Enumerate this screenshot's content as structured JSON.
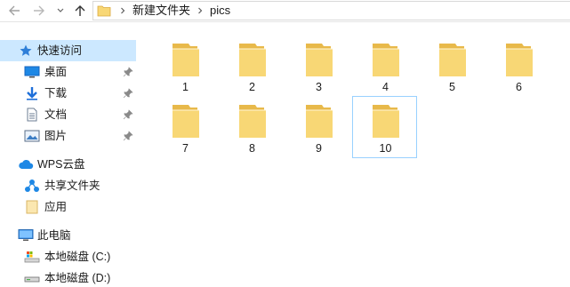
{
  "toolbar": {
    "back_icon": "arrow-left-icon",
    "forward_icon": "arrow-right-icon",
    "recent_icon": "chevron-down-icon",
    "up_icon": "arrow-up-icon"
  },
  "address_bar": {
    "breadcrumbs": [
      "新建文件夹",
      "pics"
    ]
  },
  "sidebar": {
    "items": [
      {
        "label": "快速访问",
        "icon": "star-icon",
        "selected": true
      },
      {
        "label": "桌面",
        "icon": "desktop-icon",
        "pinned": true
      },
      {
        "label": "下载",
        "icon": "download-icon",
        "pinned": true
      },
      {
        "label": "文档",
        "icon": "document-icon",
        "pinned": true
      },
      {
        "label": "图片",
        "icon": "pictures-icon",
        "pinned": true
      },
      {
        "label": "WPS云盘",
        "icon": "cloud-icon"
      },
      {
        "label": "共享文件夹",
        "icon": "share-icon"
      },
      {
        "label": "应用",
        "icon": "folder-icon"
      },
      {
        "label": "此电脑",
        "icon": "computer-icon"
      },
      {
        "label": "本地磁盘 (C:)",
        "icon": "drive-icon"
      },
      {
        "label": "本地磁盘 (D:)",
        "icon": "drive-icon"
      }
    ]
  },
  "folders": [
    {
      "name": "1"
    },
    {
      "name": "2"
    },
    {
      "name": "3"
    },
    {
      "name": "4"
    },
    {
      "name": "5"
    },
    {
      "name": "6"
    },
    {
      "name": "7"
    },
    {
      "name": "8"
    },
    {
      "name": "9"
    },
    {
      "name": "10",
      "selected": true
    }
  ],
  "colors": {
    "folder_front": "#f8d775",
    "folder_back": "#e8b94a",
    "selection_bg": "#cce8ff",
    "selection_border": "#99d1ff"
  }
}
